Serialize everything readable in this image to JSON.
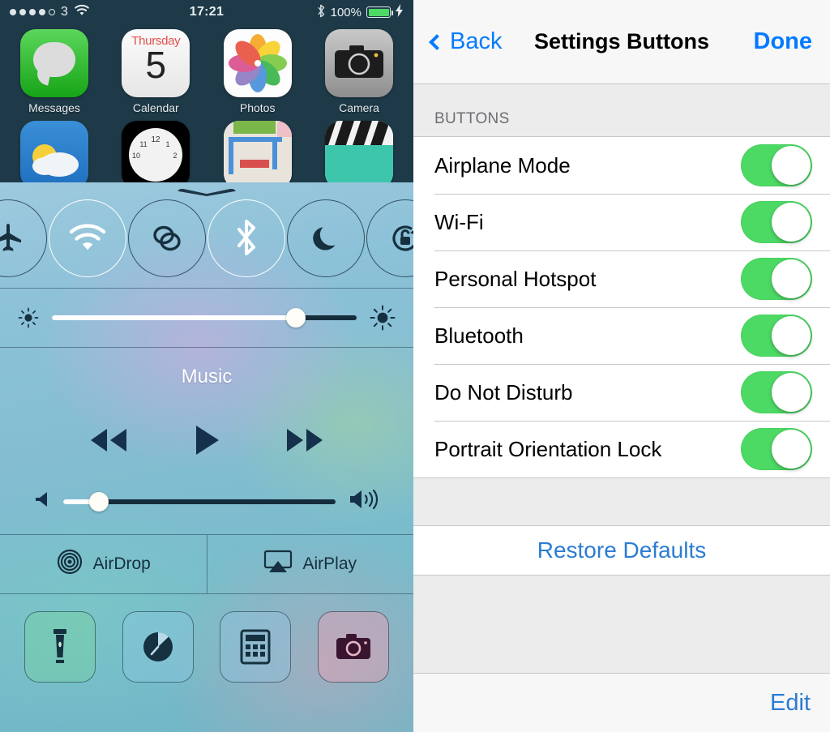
{
  "phone": {
    "status_bar": {
      "signal_dots_filled": 4,
      "signal_dots_total": 5,
      "carrier": "3",
      "wifi_icon": "wifi-icon",
      "time": "17:21",
      "bluetooth_icon": "bluetooth-icon",
      "battery_percent": "100%",
      "battery_level": 100,
      "charging_icon": "lightning-bolt-icon",
      "battery_color": "#4cd964"
    },
    "home_screen": {
      "row1": [
        {
          "name": "Messages",
          "icon": "messages-icon"
        },
        {
          "name": "Calendar",
          "icon": "calendar-icon",
          "weekday": "Thursday",
          "day": "5"
        },
        {
          "name": "Photos",
          "icon": "photos-icon"
        },
        {
          "name": "Camera",
          "icon": "camera-icon"
        }
      ],
      "row2": [
        {
          "name": "Weather",
          "icon": "weather-icon"
        },
        {
          "name": "Clock",
          "icon": "clock-icon",
          "marks": [
            "12",
            "1",
            "2",
            "10",
            "11"
          ]
        },
        {
          "name": "Maps",
          "icon": "maps-icon"
        },
        {
          "name": "Videos",
          "icon": "videos-icon"
        }
      ]
    },
    "control_center": {
      "grabber": "chevron-down-grabber",
      "toggles": [
        {
          "name": "Airplane Mode",
          "icon": "airplane-icon",
          "on": false
        },
        {
          "name": "Wi-Fi",
          "icon": "wifi-icon",
          "on": true
        },
        {
          "name": "Bluetooth Tether",
          "icon": "link-icon",
          "on": false
        },
        {
          "name": "Bluetooth",
          "icon": "bluetooth-icon",
          "on": true
        },
        {
          "name": "Do Not Disturb",
          "icon": "moon-icon",
          "on": false
        },
        {
          "name": "Portrait Orientation Lock",
          "icon": "rotation-lock-icon",
          "on": false
        }
      ],
      "brightness": {
        "label": "Brightness",
        "value_percent": 80,
        "low_icon": "brightness-low-icon",
        "high_icon": "brightness-high-icon"
      },
      "media": {
        "title": "Music",
        "previous": "rewind-icon",
        "play": "play-icon",
        "next": "fast-forward-icon",
        "volume_percent": 13,
        "volume_low_icon": "speaker-mute-icon",
        "volume_high_icon": "speaker-loud-icon"
      },
      "airdrop": {
        "label": "AirDrop",
        "icon": "airdrop-icon"
      },
      "airplay": {
        "label": "AirPlay",
        "icon": "airplay-icon"
      },
      "shortcuts": [
        {
          "name": "Flashlight",
          "icon": "flashlight-icon"
        },
        {
          "name": "Timer",
          "icon": "timer-icon"
        },
        {
          "name": "Calculator",
          "icon": "calculator-icon"
        },
        {
          "name": "Camera",
          "icon": "camera-icon"
        }
      ]
    }
  },
  "settings": {
    "navbar": {
      "back_label": "Back",
      "back_icon": "chevron-left-icon",
      "title": "Settings Buttons",
      "done_label": "Done"
    },
    "section_header": "BUTTONS",
    "rows": [
      {
        "label": "Airplane Mode",
        "on": true
      },
      {
        "label": "Wi-Fi",
        "on": true
      },
      {
        "label": "Personal Hotspot",
        "on": true
      },
      {
        "label": "Bluetooth",
        "on": true
      },
      {
        "label": "Do Not Disturb",
        "on": true
      },
      {
        "label": "Portrait Orientation Lock",
        "on": true
      }
    ],
    "restore_label": "Restore Defaults",
    "edit_label": "Edit",
    "colors": {
      "tint": "#057aff",
      "link": "#2b7cd3",
      "switch_on": "#4cd964"
    }
  }
}
